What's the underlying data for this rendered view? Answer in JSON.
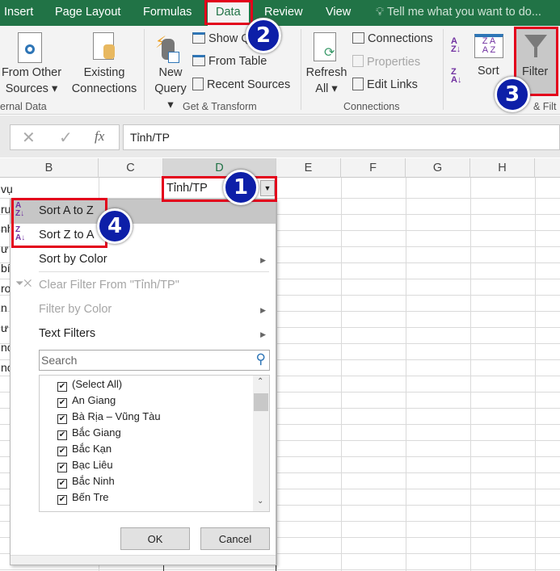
{
  "ribbon_tabs": [
    "Insert",
    "Page Layout",
    "Formulas",
    "Data",
    "Review",
    "View"
  ],
  "tell_me": "Tell me what you want to do...",
  "ribbon": {
    "from_other_sources": [
      "From Other",
      "Sources"
    ],
    "existing_connections": [
      "Existing",
      "Connections"
    ],
    "external_data_group": "ernal Data",
    "new_query": [
      "New",
      "Query"
    ],
    "show_queries": "Show Q",
    "from_table": "From Table",
    "recent_sources": "Recent Sources",
    "get_transform_group": "Get & Transform",
    "refresh_all": [
      "Refresh",
      "All"
    ],
    "connections": "Connections",
    "properties": "Properties",
    "edit_links": "Edit Links",
    "connections_group": "Connections",
    "sort": "Sort",
    "filter": "Filter",
    "sort_filter_group": "& Filt"
  },
  "formula_bar": {
    "fx": "fx",
    "value": "Tỉnh/TP"
  },
  "columns": [
    "B",
    "C",
    "D",
    "E",
    "F",
    "G",
    "H"
  ],
  "cells": {
    "b_partial": [
      "vụ",
      "ru",
      "nh",
      "ư",
      "bí",
      "rơ",
      "n",
      "ư",
      "nc",
      "nc"
    ],
    "d1": "Tỉnh/TP"
  },
  "menu": {
    "sort_az": "Sort A to Z",
    "sort_za": "Sort Z to A",
    "sort_by_color": "Sort by Color",
    "clear_filter": "Clear Filter From \"Tỉnh/TP\"",
    "filter_by_color": "Filter by Color",
    "text_filters": "Text Filters",
    "search_placeholder": "Search",
    "items": [
      {
        "label": "(Select All)",
        "checked": true
      },
      {
        "label": "An Giang",
        "checked": true
      },
      {
        "label": "Bà Rịa – Vũng Tàu",
        "checked": true
      },
      {
        "label": "Bắc Giang",
        "checked": true
      },
      {
        "label": "Bắc Kạn",
        "checked": true
      },
      {
        "label": "Bạc Liêu",
        "checked": true
      },
      {
        "label": "Bắc Ninh",
        "checked": true
      },
      {
        "label": "Bến Tre",
        "checked": true
      }
    ],
    "ok": "OK",
    "cancel": "Cancel"
  },
  "badges": [
    "1",
    "2",
    "3",
    "4"
  ],
  "colors": {
    "excel_green": "#217346",
    "highlight": "#e3001b",
    "badge": "#0d1fa8"
  }
}
